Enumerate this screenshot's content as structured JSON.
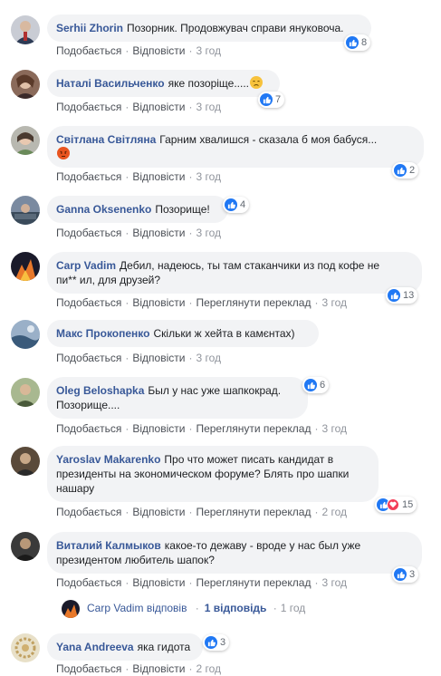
{
  "actions": {
    "like": "Подобається",
    "reply": "Відповісти",
    "translate": "Переглянути переклад",
    "dot": "·"
  },
  "colors": {
    "name": "#385898",
    "bubble": "#f2f3f5",
    "like": "#2078f4",
    "heart": "#f33e58"
  },
  "comments": [
    {
      "name": "Serhii Zhorin",
      "text": "Позорник. Продовжувач справи януковоча.",
      "reactions": "8",
      "time": "3 год",
      "reaction_icons": [
        "like-icon"
      ]
    },
    {
      "name": "Наталі Васильченко",
      "text": "яке позоріще.....",
      "emoji": "disappointed-face-icon",
      "reactions": "7",
      "time": "3 год",
      "reaction_icons": [
        "like-icon"
      ]
    },
    {
      "name": "Світлана Світляна",
      "text": "Гарним хвалишся - сказала б моя бабуся...",
      "emoji": "angry-face-icon",
      "reactions": "2",
      "time": "3 год",
      "reaction_icons": [
        "like-icon"
      ]
    },
    {
      "name": "Ganna Oksenenko",
      "text": "Позорище!",
      "reactions": "4",
      "time": "3 год",
      "reaction_icons": [
        "like-icon"
      ]
    },
    {
      "name": "Carp Vadim",
      "text_line1": "Дебил, надеюсь, ты там стаканчики из под кофе не",
      "text_line2": "пи** ил, для друзей?",
      "reactions": "13",
      "time": "3 год",
      "reaction_icons": [
        "like-icon"
      ]
    },
    {
      "name": "Макс Прокопенко",
      "text": "Скільки ж хейта в камєнтах)",
      "time": "3 год"
    },
    {
      "name": "Oleg Beloshapka",
      "text_line1": "Был у нас уже шапкокрад.",
      "text_line2": "Позорище....",
      "reactions": "6",
      "time": "3 год",
      "reaction_icons": [
        "like-icon"
      ]
    },
    {
      "name": "Yaroslav Makarenko",
      "text_line1": "Про что может писать кандидат в",
      "text_line2": "президенты на экономическом форуме? Блять про шапки",
      "text_line3": "нашару",
      "reactions": "15",
      "time": "2 год",
      "reaction_icons": [
        "like-icon",
        "heart-icon"
      ]
    },
    {
      "name": "Виталий Калмыков",
      "text_line1": "какое-то дежаву - вроде у нас был уже",
      "text_line2": "президентом любитель шапок?",
      "reactions": "3",
      "time": "3 год",
      "reaction_icons": [
        "like-icon"
      ]
    },
    {
      "name": "Yana Andreeva",
      "text": "яка гидота",
      "reactions": "3",
      "time": "2 год",
      "reaction_icons": [
        "like-icon"
      ]
    }
  ],
  "reply_summary": {
    "author": "Carp Vadim",
    "verb": "відповів",
    "count": "1 відповідь",
    "time": "1 год"
  }
}
